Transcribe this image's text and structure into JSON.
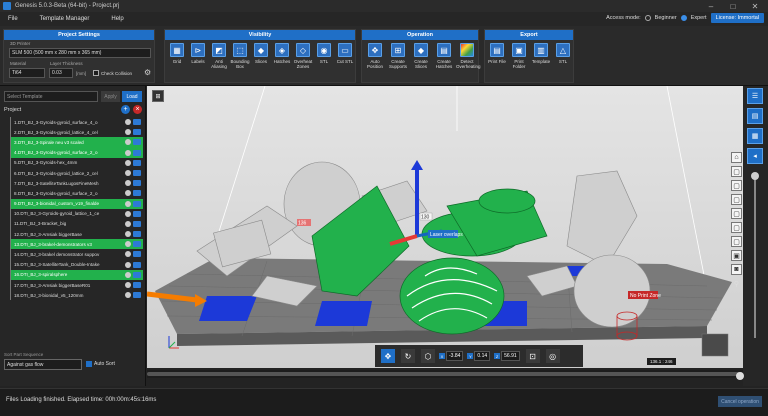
{
  "title": "Genesis 5.0.3-Beta (64-bit) - Project.prj",
  "menu": [
    "File",
    "Template Manager",
    "Help"
  ],
  "access": {
    "label": "Access mode:",
    "beginner": "Beginner",
    "expert": "Expert",
    "license": "License: Immortal"
  },
  "project_settings": {
    "header": "Project Settings",
    "printer_label": "3D Printer",
    "printer_value": "SLM 500 (500 mm x 280 mm x 365 mm)",
    "material_label": "Material",
    "material_value": "Ti64",
    "layer_label": "Layer Thickness",
    "layer_value": "0.03",
    "layer_unit": "[mm]",
    "check_collision": "Check Collision"
  },
  "visibility": {
    "header": "Visibility",
    "tools": [
      "Grid",
      "Labels",
      "Anti Aliasing",
      "Bounding Box",
      "Slices",
      "Hatches",
      "Overheat Zones",
      "STL",
      "Cut STL"
    ]
  },
  "operation": {
    "header": "Operation",
    "tools": [
      "Auto Position",
      "Create Supports",
      "Create Slices",
      "Create Hatches",
      "Detect Overheating"
    ]
  },
  "export": {
    "header": "Export",
    "tools": [
      "Print File",
      "Print Folder",
      "Template",
      "STL"
    ]
  },
  "left": {
    "template_placeholder": "Select Template",
    "apply": "Apply",
    "load": "Load",
    "project_label": "Project",
    "sort_label": "Sort Part Sequence",
    "sort_value": "Against gas flow",
    "auto_sort": "Auto Sort"
  },
  "project_items": [
    {
      "name": "1.DTI_BJ_3-Gyroids-gyroid_surface_4_o",
      "selected": false
    },
    {
      "name": "2.DTI_BJ_3-Gyroids-gyroid_lattice_4_cel",
      "selected": false
    },
    {
      "name": "3.DTI_BJ_3-Spirale neu v3 scaled",
      "selected": true
    },
    {
      "name": "4.DTI_BJ_3-Gyroids-gyroid_surface_2_o",
      "selected": true
    },
    {
      "name": "5.DTI_BJ_3-Gyroids-hex_4mm",
      "selected": false
    },
    {
      "name": "6.DTI_BJ_3-Gyroids-gyroid_lattice_2_cel",
      "selected": false
    },
    {
      "name": "7.DTI_BJ_3-SatelliteTankLugosFineMesh",
      "selected": false
    },
    {
      "name": "8.DTI_BJ_3-Gyroids-gyroid_surface_2_o",
      "selected": false
    },
    {
      "name": "9.DTI_BJ_3-bionidal_custom_v19_finalde",
      "selected": true
    },
    {
      "name": "10.DTI_BJ_3-Gyroids-gyroid_lattice_1_ce",
      "selected": false
    },
    {
      "name": "11.DTI_BJ_3-Bracket_big",
      "selected": false
    },
    {
      "name": "12.DTI_BJ_3-Amsiak biggerBase",
      "selected": false
    },
    {
      "name": "13.DTI_BJ_3-brakel-demonstrators v3",
      "selected": true
    },
    {
      "name": "14.DTI_BJ_3-brakel demonstrator suppov",
      "selected": false
    },
    {
      "name": "15.DTI_BJ_3-SatelliteTank_Double-Intake",
      "selected": false
    },
    {
      "name": "16.DTI_BJ_3-spiralsphere",
      "selected": true
    },
    {
      "name": "17.DTI_BJ_3-Amsiak biggerBaseR01",
      "selected": false
    },
    {
      "name": "18.DTI_BJ_3-bionidal_v5_120mm",
      "selected": false
    }
  ],
  "viewport": {
    "laser_overlaps": "Laser overlaps",
    "no_print_zone": "No Print Zone",
    "label_136": "136",
    "label_130": "130",
    "coord_readout": "136.1 : 246",
    "x_value": "-3.84",
    "y_value": "0.14",
    "z_value": "56.91"
  },
  "status": {
    "message": "Files Loading finished. Elapsed time: 00h:00m:45s:16ms",
    "cancel": "Cancel operation"
  },
  "colors": {
    "accent": "#1f6fc7",
    "selected_row": "#22b14c",
    "part_green": "#22b14c",
    "build_plate": "#808080",
    "blue_patch": "#1c39d8"
  }
}
